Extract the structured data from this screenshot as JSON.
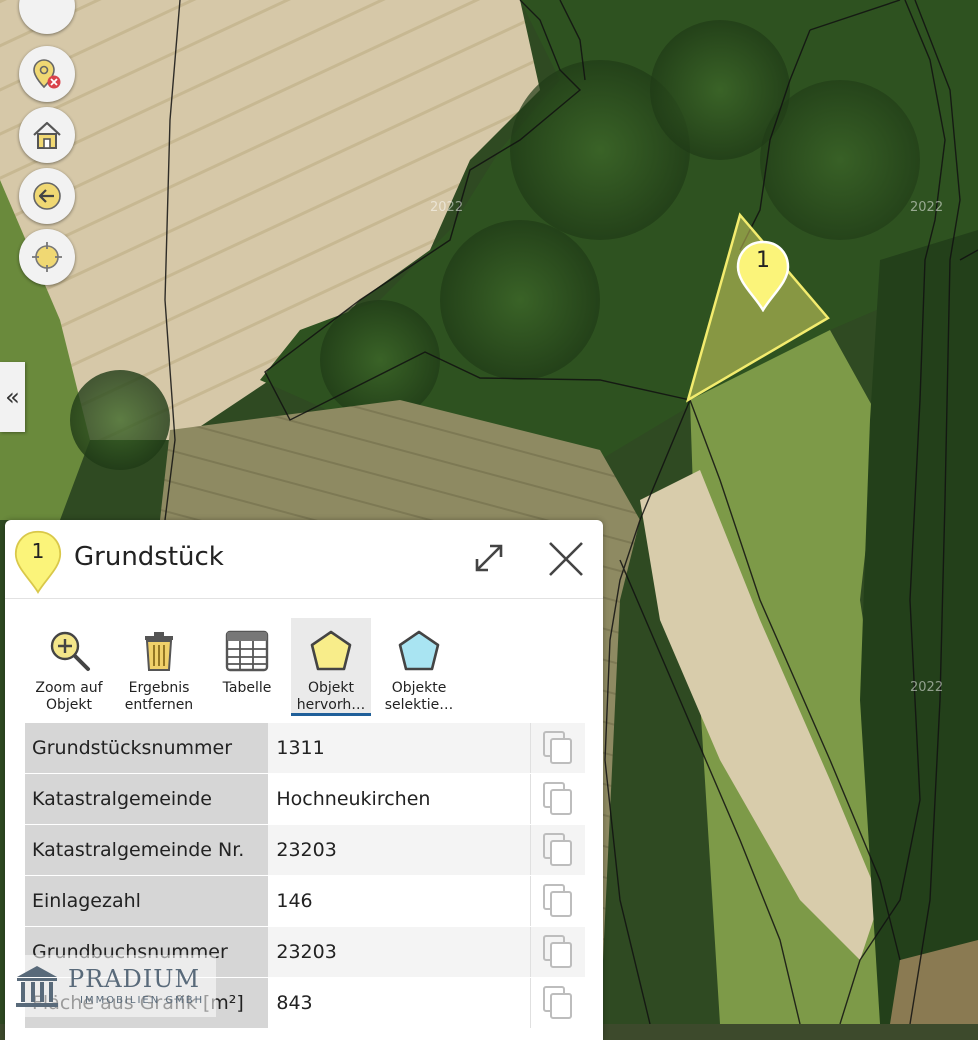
{
  "map": {
    "year_labels": [
      "2022",
      "2022",
      "2022"
    ],
    "parcel_marker": "1",
    "collapse_glyph": "«",
    "tools": [
      "remove-marker-icon",
      "home-icon",
      "back-icon",
      "locate-icon"
    ]
  },
  "panel": {
    "marker": "1",
    "title": "Grundstück",
    "toolbar": [
      {
        "label_1": "Zoom auf",
        "label_2": "Objekt",
        "icon": "zoom-in-icon"
      },
      {
        "label_1": "Ergebnis",
        "label_2": "entfernen",
        "icon": "trash-icon"
      },
      {
        "label_1": "Tabelle",
        "label_2": "",
        "icon": "table-icon"
      },
      {
        "label_1": "Objekt",
        "label_2": "hervorh…",
        "icon": "highlight-polygon-icon"
      },
      {
        "label_1": "Objekte",
        "label_2": "selektie…",
        "icon": "select-polygon-icon"
      }
    ],
    "rows": [
      {
        "key": "Grundstücksnummer",
        "value": "1311"
      },
      {
        "key": "Katastralgemeinde",
        "value": "Hochneukirchen"
      },
      {
        "key": "Katastralgemeinde Nr.",
        "value": "23203"
      },
      {
        "key": "Einlagezahl",
        "value": "146"
      },
      {
        "key": "Grundbuchsnummer",
        "value": "23203"
      },
      {
        "key": "Fläche aus Grafik [m²]",
        "value": "843"
      }
    ]
  },
  "watermark": {
    "name": "PRADIUM",
    "sub": "IMMOBILIEN GMBH"
  },
  "colors": {
    "highlight": "#f3ec6e",
    "select": "#8fd8ee",
    "accent": "#1f5f99"
  }
}
